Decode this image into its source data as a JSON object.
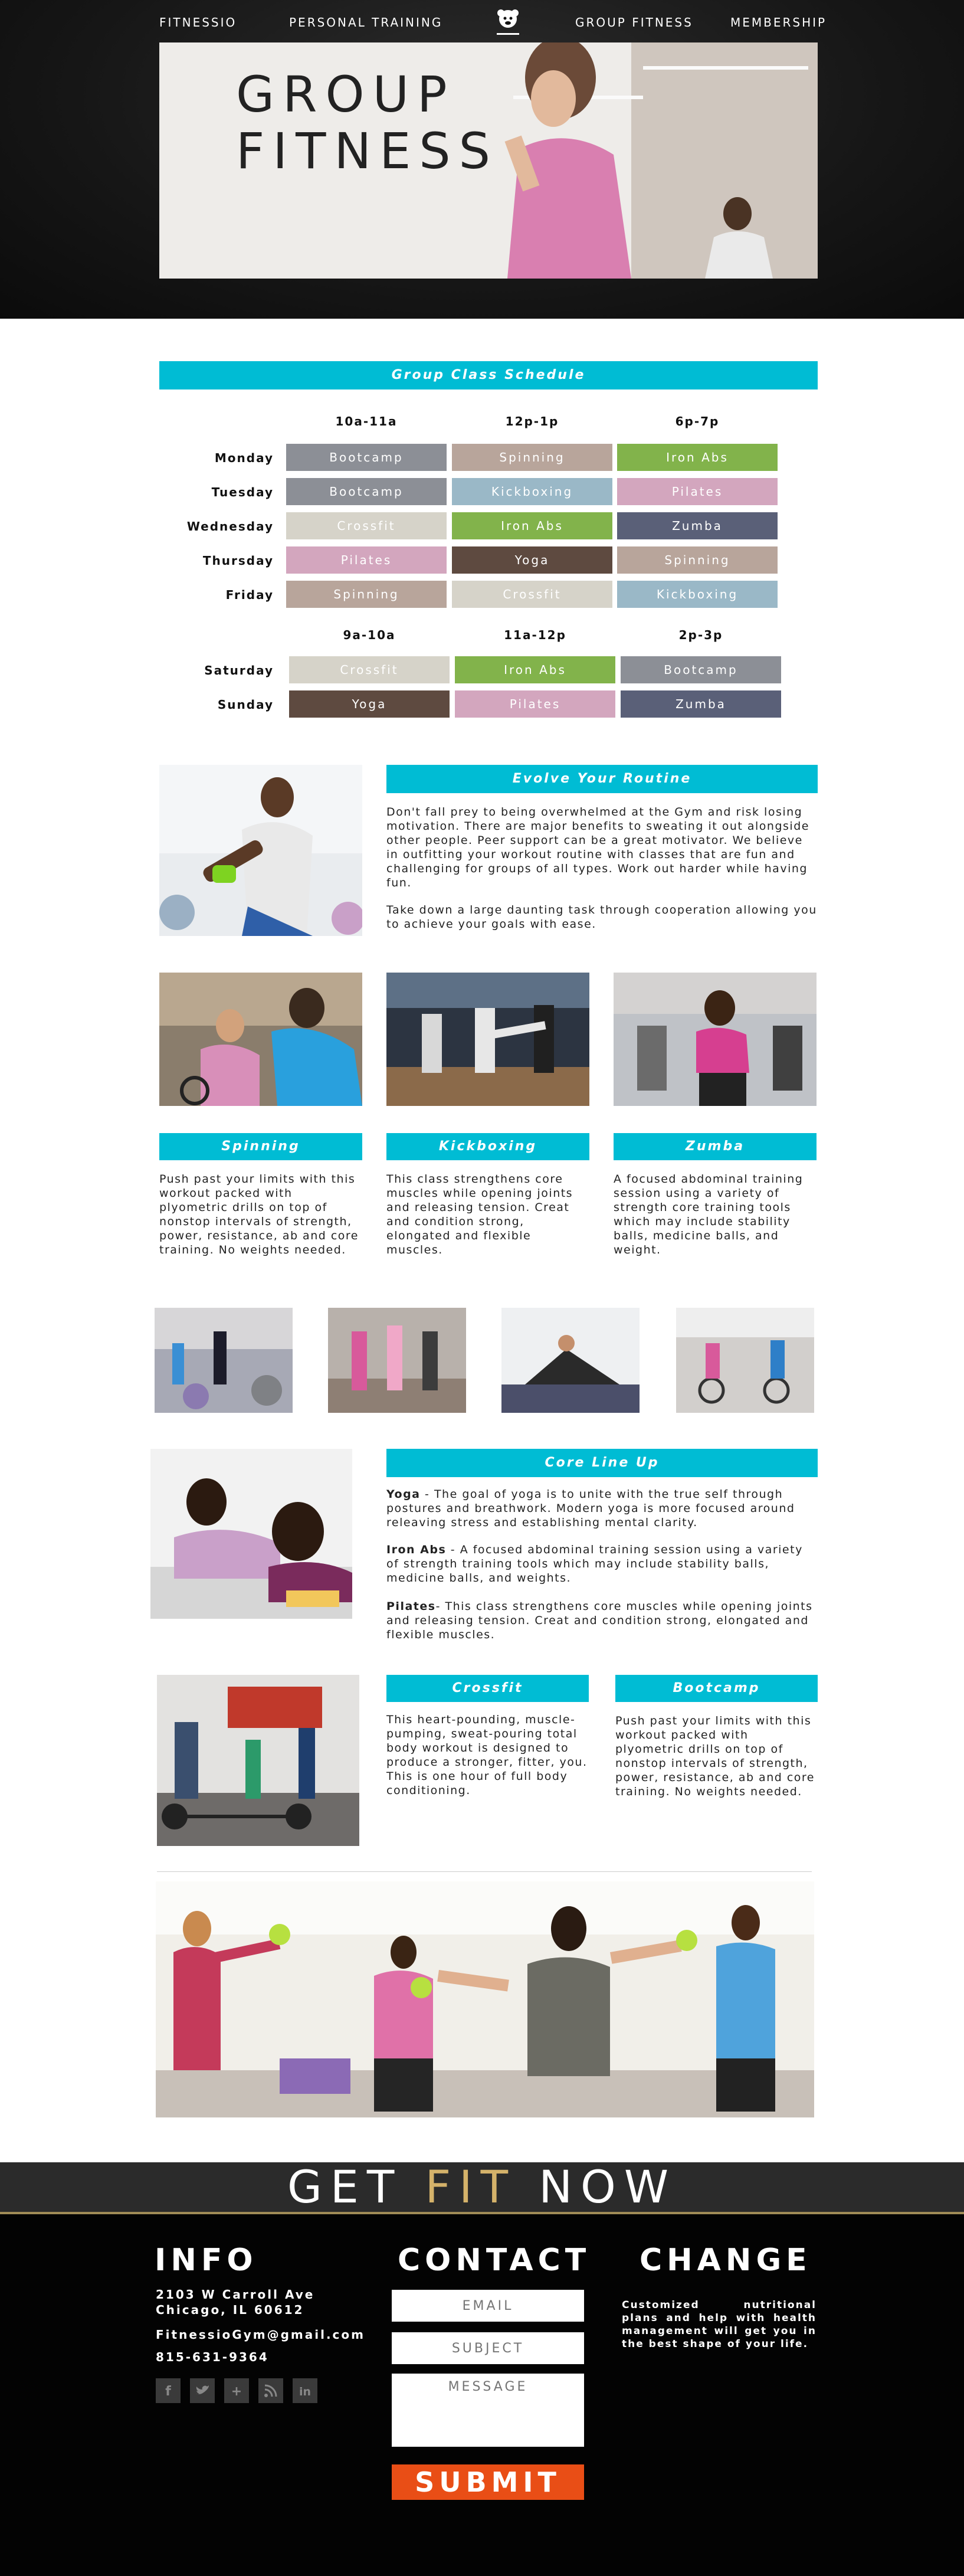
{
  "nav": {
    "left": [
      "FITNESSIO",
      "PERSONAL TRAINING"
    ],
    "right": [
      "GROUP FITNESS",
      "MEMBERSHIP"
    ],
    "logo_text": "FITNESSIO"
  },
  "hero": {
    "title_line1": "GROUP",
    "title_line2": "FITNESS"
  },
  "schedule": {
    "title": "Group Class Schedule",
    "weekday_times": [
      "10a-11a",
      "12p-1p",
      "6p-7p"
    ],
    "weekdays": [
      {
        "day": "Monday",
        "classes": [
          "Bootcamp",
          "Spinning",
          "Iron Abs"
        ]
      },
      {
        "day": "Tuesday",
        "classes": [
          "Bootcamp",
          "Kickboxing",
          "Pilates"
        ]
      },
      {
        "day": "Wednesday",
        "classes": [
          "Crossfit",
          "Iron Abs",
          "Zumba"
        ]
      },
      {
        "day": "Thursday",
        "classes": [
          "Pilates",
          "Yoga",
          "Spinning"
        ]
      },
      {
        "day": "Friday",
        "classes": [
          "Spinning",
          "Crossfit",
          "Kickboxing"
        ]
      }
    ],
    "weekend_times": [
      "9a-10a",
      "11a-12p",
      "2p-3p"
    ],
    "weekend": [
      {
        "day": "Saturday",
        "classes": [
          "Crossfit",
          "Iron Abs",
          "Bootcamp"
        ]
      },
      {
        "day": "Sunday",
        "classes": [
          "Yoga",
          "Pilates",
          "Zumba"
        ]
      }
    ],
    "class_colors": {
      "Bootcamp": "#8c8f96",
      "Spinning": "#b8a59b",
      "Iron Abs": "#82b34b",
      "Kickboxing": "#9ab8c7",
      "Pilates": "#d3a6be",
      "Crossfit": "#d6d3c9",
      "Zumba": "#5a6078",
      "Yoga": "#5e4a40"
    }
  },
  "evolve": {
    "title": "Evolve Your Routine",
    "para1": "Don't fall prey to being overwhelmed at the Gym and risk losing motivation. There are major benefits to sweating it out alongside other people. Peer support can be a great motivator. We believe in outfitting your workout routine with classes that are fun and challenging for groups of all types. Work out harder while having fun.",
    "para2": "Take down a large daunting task through cooperation allowing you to achieve your goals with ease."
  },
  "classes3": [
    {
      "title": "Spinning",
      "text": "Push past your limits with this workout packed with plyometric drills on top of nonstop intervals of strength, power, resistance, ab and core training. No weights needed."
    },
    {
      "title": "Kickboxing",
      "text": "This class strengthens core muscles while opening joints and releasing tension. Creat and condition strong, elongated and flexible muscles."
    },
    {
      "title": "Zumba",
      "text": "A focused abdominal training session using a variety of strength core training tools which may include stability balls, medicine balls, and weight."
    }
  ],
  "core": {
    "title": "Core Line Up",
    "items": [
      {
        "name": "Yoga",
        "sep": " - ",
        "text": "The goal of yoga is to unite with the true self through postures and breathwork. Modern yoga is more focused around releaving stress and establishing mental clarity."
      },
      {
        "name": "Iron Abs",
        "sep": " - ",
        "text": "A focused abdominal training session using a variety of strength training tools which may include stability balls, medicine balls, and weights."
      },
      {
        "name": "Pilates",
        "sep": "- ",
        "text": "This class strengthens core muscles while opening joints and releasing tension. Creat and condition strong, elongated and flexible muscles."
      }
    ]
  },
  "crossfit": {
    "title": "Crossfit",
    "text": "This heart-pounding, muscle-pumping, sweat-pouring total body workout is designed to produce a stronger, fitter, you. This is one hour of full body conditioning."
  },
  "bootcamp": {
    "title": "Bootcamp",
    "text": "Push past your limits with this workout packed with plyometric drills on top of nonstop intervals of strength, power, resistance, ab and core training. No weights needed."
  },
  "cta": {
    "part1": "GET",
    "part2": "FIT",
    "part3": "NOW"
  },
  "footer": {
    "info_head": "INFO",
    "address1": "2103 W Carroll Ave",
    "address2": "Chicago, IL 60612",
    "email": "FitnessioGym@gmail.com",
    "phone": "815-631-9364",
    "contact_head": "CONTACT",
    "email_placeholder": "EMAIL",
    "subject_placeholder": "SUBJECT",
    "message_placeholder": "MESSAGE",
    "submit_label": "SUBMIT",
    "change_head": "CHANGE",
    "change_text": "Customized nutritional plans and help with health management will get you in the best shape of your life.",
    "social_icons": [
      "facebook-icon",
      "twitter-icon",
      "google-plus-icon",
      "rss-icon",
      "linkedin-icon"
    ]
  }
}
